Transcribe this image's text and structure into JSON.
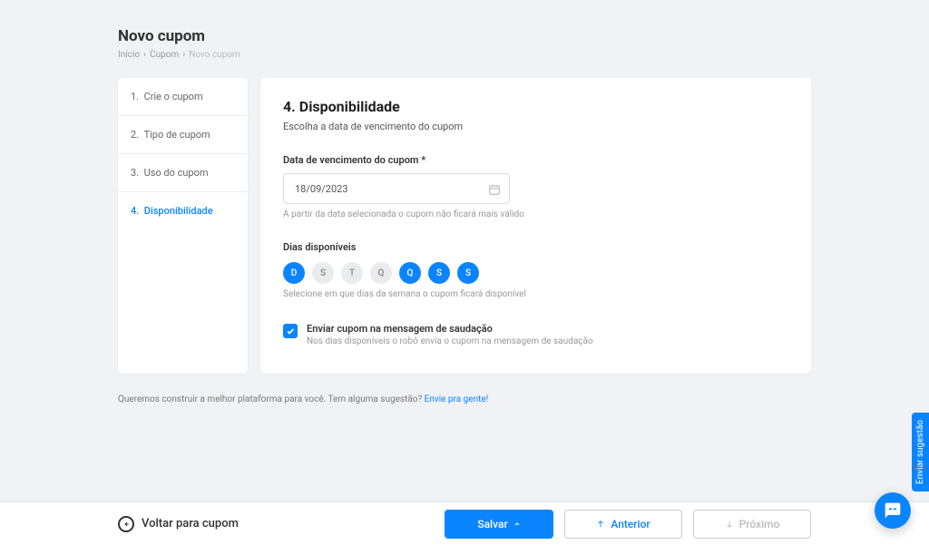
{
  "page": {
    "title": "Novo cupom"
  },
  "breadcrumb": {
    "home": "Início",
    "parent": "Cupom",
    "current": "Novo cupom"
  },
  "sidebar": {
    "items": [
      {
        "num": "1.",
        "label": "Crie o cupom"
      },
      {
        "num": "2.",
        "label": "Tipo de cupom"
      },
      {
        "num": "3.",
        "label": "Uso do cupom"
      },
      {
        "num": "4.",
        "label": "Disponibilidade"
      }
    ]
  },
  "content": {
    "section_title": "4. Disponibilidade",
    "section_subtitle": "Escolha a data de vencimento do cupom",
    "expiry_label": "Data de vencimento do cupom *",
    "expiry_value": "18/09/2023",
    "expiry_helper": "A partir da data selecionada o cupom não ficará mais válido",
    "days_label": "Dias disponíveis",
    "days": [
      {
        "letter": "D",
        "selected": true
      },
      {
        "letter": "S",
        "selected": false
      },
      {
        "letter": "T",
        "selected": false
      },
      {
        "letter": "Q",
        "selected": false
      },
      {
        "letter": "Q",
        "selected": true
      },
      {
        "letter": "S",
        "selected": true
      },
      {
        "letter": "S",
        "selected": true
      }
    ],
    "days_helper": "Selecione em que dias da semana o cupom ficará disponível",
    "greeting_checkbox_label": "Enviar cupom na mensagem de saudação",
    "greeting_checkbox_desc": "Nos dias disponíveis o robô envia o cupom na mensagem de saudação"
  },
  "suggestion": {
    "text": "Queremos construir a melhor plataforma para você. Tem alguma sugestão? ",
    "link": "Envie pra gente!"
  },
  "footer": {
    "back": "Voltar para cupom",
    "save": "Salvar",
    "previous": "Anterior",
    "next": "Próximo"
  },
  "side_tab": "Enviar sugestão"
}
